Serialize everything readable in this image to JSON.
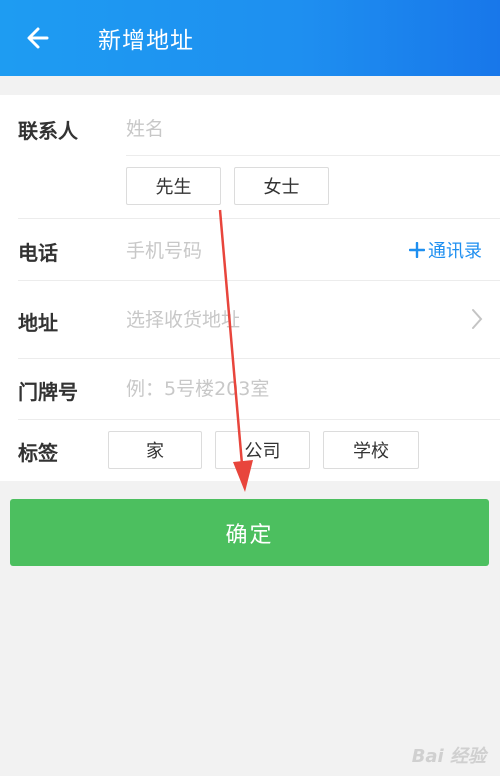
{
  "header": {
    "title": "新增地址"
  },
  "form": {
    "contact": {
      "label": "联系人",
      "placeholder": "姓名",
      "salutations": [
        "先生",
        "女士"
      ]
    },
    "phone": {
      "label": "电话",
      "placeholder": "手机号码",
      "contacts_link": "通讯录"
    },
    "address": {
      "label": "地址",
      "placeholder": "选择收货地址"
    },
    "doorplate": {
      "label": "门牌号",
      "placeholder": "例：5号楼203室"
    },
    "tags": {
      "label": "标签",
      "options": [
        "家",
        "公司",
        "学校"
      ]
    }
  },
  "confirm_label": "确定",
  "watermark": "Bai 经验",
  "colors": {
    "appbar": "#1e8ff0",
    "confirm": "#4cbf5f",
    "link": "#1e8ff0",
    "annotation_arrow": "#e8453c"
  },
  "icons": {
    "back": "arrow-left-icon",
    "add": "plus-icon",
    "chevron": "chevron-right-icon"
  }
}
